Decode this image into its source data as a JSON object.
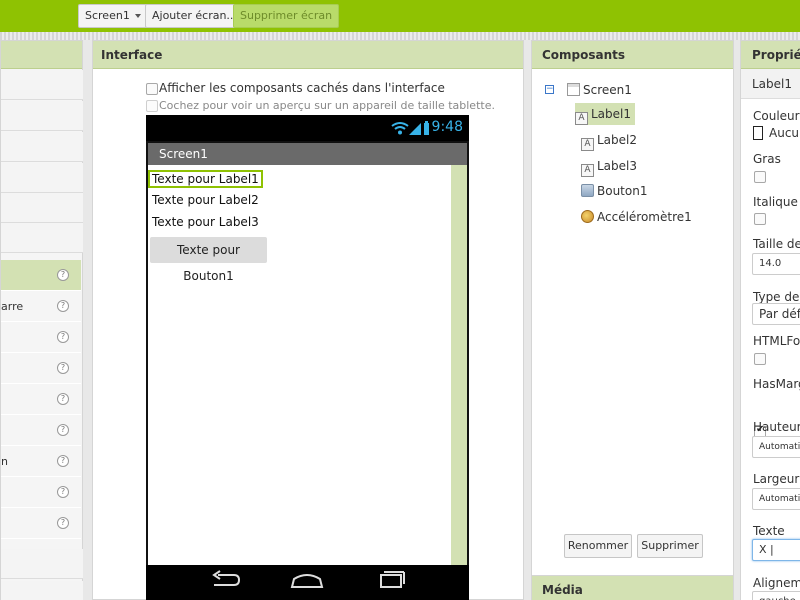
{
  "toolbar": {
    "screen_select": "Screen1",
    "add_screen": "Ajouter écran...",
    "remove_screen": "Supprimer écran"
  },
  "palette": {
    "items": [
      {
        "label": "",
        "help": "?"
      },
      {
        "label": "arre",
        "help": "?"
      },
      {
        "label": "",
        "help": "?"
      },
      {
        "label": "",
        "help": "?"
      },
      {
        "label": "",
        "help": "?"
      },
      {
        "label": "",
        "help": "?"
      },
      {
        "label": "n",
        "help": "?"
      },
      {
        "label": "",
        "help": "?"
      },
      {
        "label": "",
        "help": "?"
      }
    ]
  },
  "viewer": {
    "title": "Interface",
    "show_hidden": "Afficher les composants cachés dans l'interface",
    "tablet_preview": "Cochez pour voir un aperçu sur un appareil de taille tablette.",
    "phone": {
      "time": "9:48",
      "screen_title": "Screen1",
      "labels": [
        "Texte pour Label1",
        "Texte pour Label2",
        "Texte pour Label3"
      ],
      "button": "Texte pour Bouton1"
    }
  },
  "components": {
    "title": "Composants",
    "root": {
      "label": "Screen1",
      "icon": "screen-icon"
    },
    "children": [
      {
        "label": "Label1",
        "icon": "label-icon"
      },
      {
        "label": "Label2",
        "icon": "label-icon"
      },
      {
        "label": "Label3",
        "icon": "label-icon"
      },
      {
        "label": "Bouton1",
        "icon": "button-icon"
      },
      {
        "label": "Accéléromètre1",
        "icon": "accelerometer-icon"
      }
    ],
    "rename": "Renommer",
    "delete": "Supprimer"
  },
  "media": {
    "title": "Média"
  },
  "properties": {
    "title": "Propriété",
    "component": "Label1",
    "background_color": {
      "label": "Couleur d",
      "value": "Aucu"
    },
    "bold": {
      "label": "Gras"
    },
    "italic": {
      "label": "Italique"
    },
    "font_size": {
      "label": "Taille de p",
      "value": "14.0"
    },
    "font_type": {
      "label": "Type de p",
      "value": "Par défau"
    },
    "html_format": {
      "label": "HTMLFor"
    },
    "has_margins": {
      "label": "HasMarg"
    },
    "height": {
      "label": "Hauteur",
      "value": "Automatiq"
    },
    "width": {
      "label": "Largeur",
      "value": "Automatiq"
    },
    "text": {
      "label": "Texte",
      "value": "X"
    },
    "alignment": {
      "label": "Alignemen",
      "value": "gauche"
    }
  },
  "colors": {
    "topbar": "#8fc202",
    "panel_header": "#d3e1b3",
    "clock": "#38b3e8"
  }
}
